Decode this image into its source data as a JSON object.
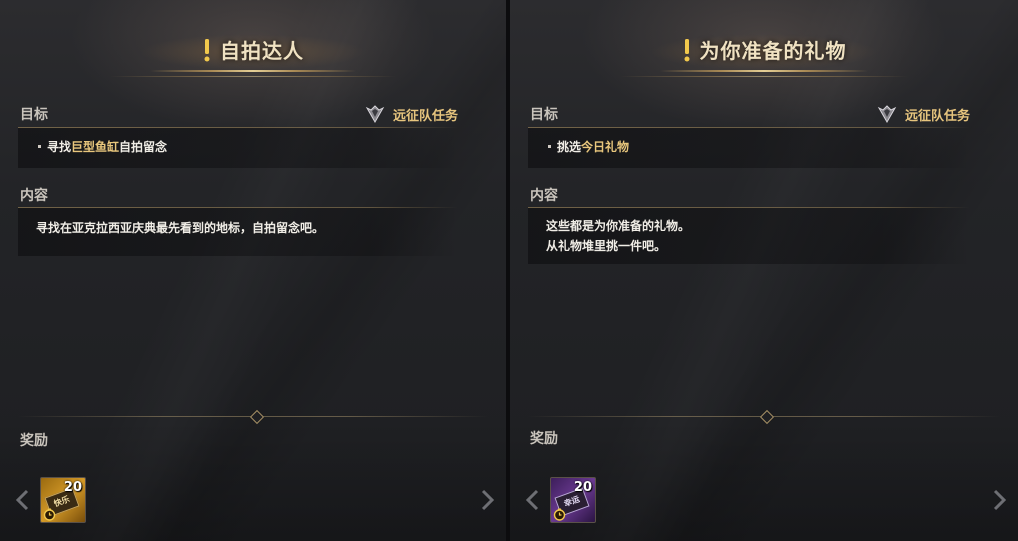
{
  "left": {
    "title": "自拍达人",
    "objective_label": "目标",
    "quest_type": "远征队任务",
    "objective": {
      "prefix": "寻找",
      "highlight": "巨型鱼缸",
      "suffix": "自拍留念"
    },
    "content_label": "内容",
    "content_lines": [
      "寻找在亚克拉西亚庆典最先看到的地标，自拍留念吧。"
    ],
    "reward_label": "奖励",
    "reward": {
      "count": "20",
      "ticket_text": "快乐",
      "color": "#d49a28"
    }
  },
  "right": {
    "title": "为你准备的礼物",
    "objective_label": "目标",
    "quest_type": "远征队任务",
    "objective": {
      "prefix": "挑选",
      "highlight": "今日礼物",
      "suffix": ""
    },
    "content_label": "内容",
    "content_lines": [
      "这些都是为你准备的礼物。",
      "从礼物堆里挑一件吧。"
    ],
    "reward_label": "奖励",
    "reward": {
      "count": "20",
      "ticket_text": "幸运",
      "color": "#6b3a92"
    }
  },
  "icons": {
    "quest_marker": "exclamation-icon",
    "quest_type": "expedition-crest-icon",
    "nav_prev": "chevron-left-icon",
    "nav_next": "chevron-right-icon",
    "timer": "clock-icon"
  },
  "colors": {
    "accent_gold": "#e7c57e",
    "title": "#f0e2c2",
    "text": "#f0ede6"
  }
}
